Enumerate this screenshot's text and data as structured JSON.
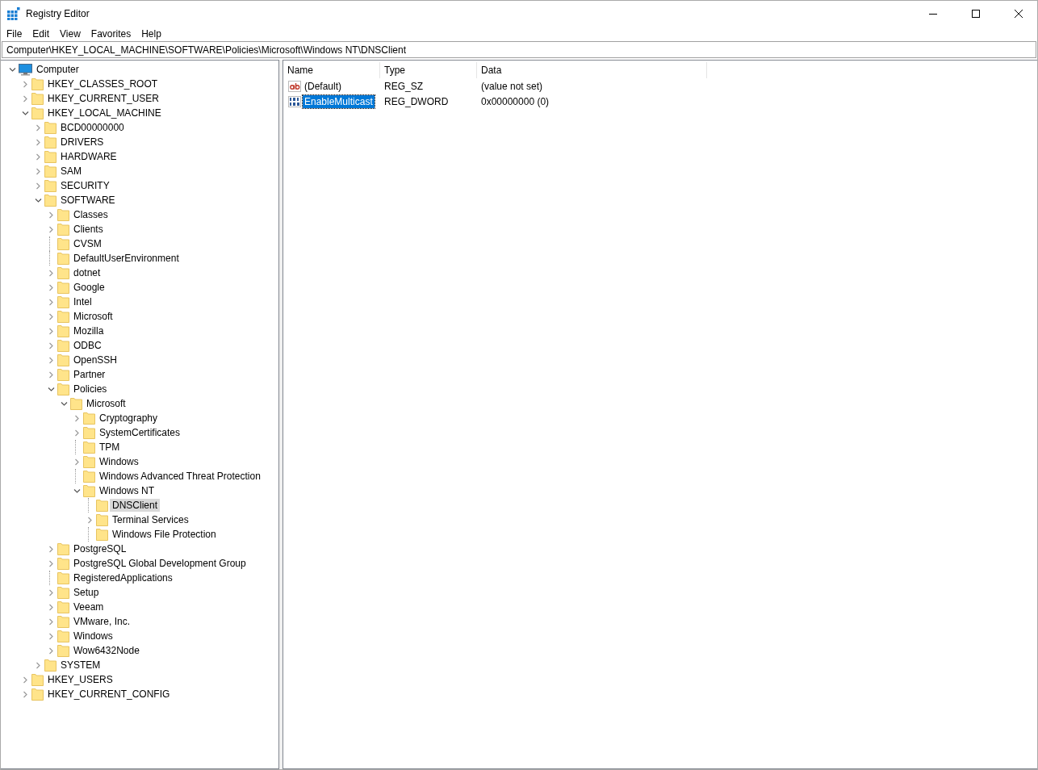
{
  "window": {
    "title": "Registry Editor"
  },
  "menu": [
    "File",
    "Edit",
    "View",
    "Favorites",
    "Help"
  ],
  "address": "Computer\\HKEY_LOCAL_MACHINE\\SOFTWARE\\Policies\\Microsoft\\Windows NT\\DNSClient",
  "tree": [
    {
      "label": "Computer",
      "kind": "computer",
      "expanded": true,
      "selected": false,
      "children": [
        {
          "label": "HKEY_CLASSES_ROOT",
          "kind": "branch",
          "expanded": false,
          "selected": false
        },
        {
          "label": "HKEY_CURRENT_USER",
          "kind": "branch",
          "expanded": false,
          "selected": false
        },
        {
          "label": "HKEY_LOCAL_MACHINE",
          "kind": "branch",
          "expanded": true,
          "selected": false,
          "children": [
            {
              "label": "BCD00000000",
              "kind": "branch",
              "expanded": false,
              "selected": false
            },
            {
              "label": "DRIVERS",
              "kind": "branch",
              "expanded": false,
              "selected": false
            },
            {
              "label": "HARDWARE",
              "kind": "branch",
              "expanded": false,
              "selected": false
            },
            {
              "label": "SAM",
              "kind": "branch",
              "expanded": false,
              "selected": false
            },
            {
              "label": "SECURITY",
              "kind": "branch",
              "expanded": false,
              "selected": false
            },
            {
              "label": "SOFTWARE",
              "kind": "branch",
              "expanded": true,
              "selected": false,
              "children": [
                {
                  "label": "Classes",
                  "kind": "branch",
                  "expanded": false,
                  "selected": false
                },
                {
                  "label": "Clients",
                  "kind": "branch",
                  "expanded": false,
                  "selected": false
                },
                {
                  "label": "CVSM",
                  "kind": "leaf",
                  "selected": false
                },
                {
                  "label": "DefaultUserEnvironment",
                  "kind": "leaf",
                  "selected": false
                },
                {
                  "label": "dotnet",
                  "kind": "branch",
                  "expanded": false,
                  "selected": false
                },
                {
                  "label": "Google",
                  "kind": "branch",
                  "expanded": false,
                  "selected": false
                },
                {
                  "label": "Intel",
                  "kind": "branch",
                  "expanded": false,
                  "selected": false
                },
                {
                  "label": "Microsoft",
                  "kind": "branch",
                  "expanded": false,
                  "selected": false
                },
                {
                  "label": "Mozilla",
                  "kind": "branch",
                  "expanded": false,
                  "selected": false
                },
                {
                  "label": "ODBC",
                  "kind": "branch",
                  "expanded": false,
                  "selected": false
                },
                {
                  "label": "OpenSSH",
                  "kind": "branch",
                  "expanded": false,
                  "selected": false
                },
                {
                  "label": "Partner",
                  "kind": "branch",
                  "expanded": false,
                  "selected": false
                },
                {
                  "label": "Policies",
                  "kind": "branch",
                  "expanded": true,
                  "selected": false,
                  "children": [
                    {
                      "label": "Microsoft",
                      "kind": "branch",
                      "expanded": true,
                      "selected": false,
                      "children": [
                        {
                          "label": "Cryptography",
                          "kind": "branch",
                          "expanded": false,
                          "selected": false
                        },
                        {
                          "label": "SystemCertificates",
                          "kind": "branch",
                          "expanded": false,
                          "selected": false
                        },
                        {
                          "label": "TPM",
                          "kind": "leaf",
                          "selected": false
                        },
                        {
                          "label": "Windows",
                          "kind": "branch",
                          "expanded": false,
                          "selected": false
                        },
                        {
                          "label": "Windows Advanced Threat Protection",
                          "kind": "leaf",
                          "selected": false
                        },
                        {
                          "label": "Windows NT",
                          "kind": "branch",
                          "expanded": true,
                          "selected": false,
                          "children": [
                            {
                              "label": "DNSClient",
                              "kind": "leaf",
                              "selected": true
                            },
                            {
                              "label": "Terminal Services",
                              "kind": "branch",
                              "expanded": false,
                              "selected": false
                            },
                            {
                              "label": "Windows File Protection",
                              "kind": "leaf",
                              "selected": false
                            }
                          ]
                        }
                      ]
                    }
                  ]
                },
                {
                  "label": "PostgreSQL",
                  "kind": "branch",
                  "expanded": false,
                  "selected": false
                },
                {
                  "label": "PostgreSQL Global Development Group",
                  "kind": "branch",
                  "expanded": false,
                  "selected": false
                },
                {
                  "label": "RegisteredApplications",
                  "kind": "leaf",
                  "selected": false
                },
                {
                  "label": "Setup",
                  "kind": "branch",
                  "expanded": false,
                  "selected": false
                },
                {
                  "label": "Veeam",
                  "kind": "branch",
                  "expanded": false,
                  "selected": false
                },
                {
                  "label": "VMware, Inc.",
                  "kind": "branch",
                  "expanded": false,
                  "selected": false
                },
                {
                  "label": "Windows",
                  "kind": "branch",
                  "expanded": false,
                  "selected": false
                },
                {
                  "label": "Wow6432Node",
                  "kind": "branch",
                  "expanded": false,
                  "selected": false
                }
              ]
            },
            {
              "label": "SYSTEM",
              "kind": "branch",
              "expanded": false,
              "selected": false
            }
          ]
        },
        {
          "label": "HKEY_USERS",
          "kind": "branch",
          "expanded": false,
          "selected": false
        },
        {
          "label": "HKEY_CURRENT_CONFIG",
          "kind": "branch",
          "expanded": false,
          "selected": false
        }
      ]
    }
  ],
  "values": {
    "columns": [
      "Name",
      "Type",
      "Data"
    ],
    "rows": [
      {
        "kind": "string",
        "name": "(Default)",
        "type": "REG_SZ",
        "data": "(value not set)",
        "selected": false
      },
      {
        "kind": "binary",
        "name": "EnableMulticast",
        "type": "REG_DWORD",
        "data": "0x00000000 (0)",
        "selected": true
      }
    ]
  }
}
